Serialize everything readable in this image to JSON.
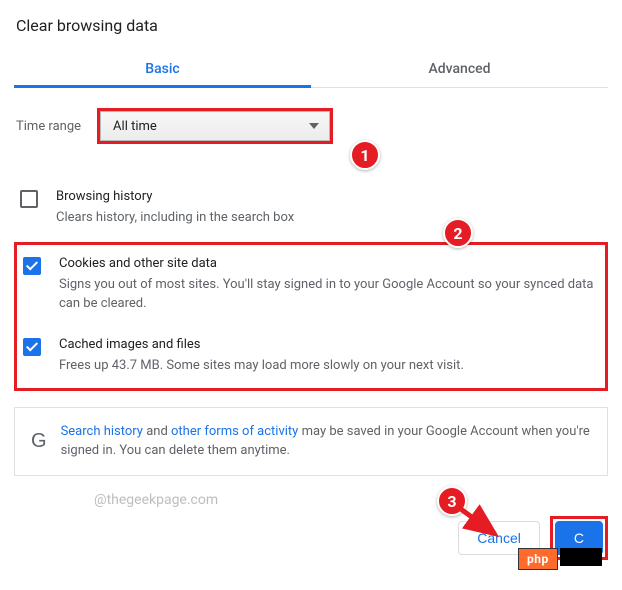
{
  "title": "Clear browsing data",
  "tabs": {
    "basic": "Basic",
    "advanced": "Advanced"
  },
  "timerange": {
    "label": "Time range",
    "value": "All time"
  },
  "items": [
    {
      "title": "Browsing history",
      "desc": "Clears history, including in the search box",
      "checked": false
    },
    {
      "title": "Cookies and other site data",
      "desc": "Signs you out of most sites. You'll stay signed in to your Google Account so your synced data can be cleared.",
      "checked": true
    },
    {
      "title": "Cached images and files",
      "desc": "Frees up 43.7 MB. Some sites may load more slowly on your next visit.",
      "checked": true
    }
  ],
  "info": {
    "link1": "Search history",
    "mid1": " and ",
    "link2": "other forms of activity",
    "rest": " may be saved in your Google Account when you're signed in. You can delete them anytime."
  },
  "watermark": "@thegeekpage.com",
  "buttons": {
    "cancel": "Cancel",
    "clear": "C"
  },
  "annotations": {
    "b1": "1",
    "b2": "2",
    "b3": "3"
  },
  "overlay": {
    "php": "php"
  }
}
